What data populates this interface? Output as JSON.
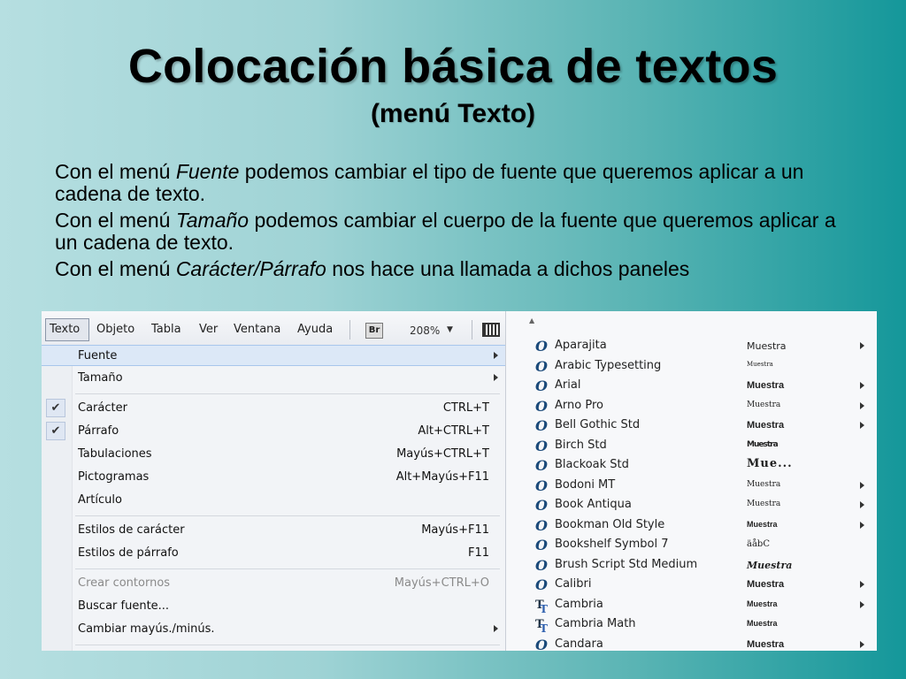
{
  "slide": {
    "title": "Colocación básica de textos",
    "subtitle": "(menú Texto)",
    "bullets": [
      {
        "pre": "Con el menú ",
        "em": "Fuente",
        "post": " podemos cambiar el tipo de fuente que queremos aplicar a un cadena de texto."
      },
      {
        "pre": "Con el menú ",
        "em": "Tamaño",
        "post": " podemos cambiar el cuerpo de la fuente que queremos aplicar a un cadena de texto."
      },
      {
        "pre": "Con el menú ",
        "em": "Carácter/Párrafo",
        "post": " nos hace una llamada a dichos paneles"
      }
    ]
  },
  "menubar": {
    "items": [
      "Texto",
      "Objeto",
      "Tabla",
      "Ver",
      "Ventana",
      "Ayuda"
    ],
    "br_label": "Br",
    "zoom": "208%"
  },
  "menu": {
    "items": [
      {
        "label": "Fuente",
        "shortcut": "",
        "submenu": true
      },
      {
        "label": "Tamaño",
        "shortcut": "",
        "submenu": true
      },
      {
        "label": "Carácter",
        "shortcut": "CTRL+T",
        "checked": true
      },
      {
        "label": "Párrafo",
        "shortcut": "Alt+CTRL+T",
        "checked": true
      },
      {
        "label": "Tabulaciones",
        "shortcut": "Mayús+CTRL+T"
      },
      {
        "label": "Pictogramas",
        "shortcut": "Alt+Mayús+F11"
      },
      {
        "label": "Artículo",
        "shortcut": ""
      },
      {
        "label": "Estilos de carácter",
        "shortcut": "Mayús+F11"
      },
      {
        "label": "Estilos de párrafo",
        "shortcut": "F11"
      },
      {
        "label": "Crear contornos",
        "shortcut": "Mayús+CTRL+O",
        "disabled": true
      },
      {
        "label": "Buscar fuente...",
        "shortcut": ""
      },
      {
        "label": "Cambiar mayús./minús.",
        "shortcut": "",
        "submenu": true
      }
    ]
  },
  "fonts": {
    "items": [
      {
        "name": "Aparajita",
        "sample": "Muestra",
        "icon": "opentype-icon",
        "arrow": true
      },
      {
        "name": "Arabic Typesetting",
        "sample": "Muestra",
        "icon": "opentype-icon",
        "arrow": false
      },
      {
        "name": "Arial",
        "sample": "Muestra",
        "icon": "opentype-icon",
        "arrow": true
      },
      {
        "name": "Arno Pro",
        "sample": "Muestra",
        "icon": "opentype-icon",
        "arrow": true
      },
      {
        "name": "Bell Gothic Std",
        "sample": "Muestra",
        "icon": "opentype-icon",
        "arrow": true
      },
      {
        "name": "Birch Std",
        "sample": "Muestra",
        "icon": "opentype-icon",
        "arrow": false
      },
      {
        "name": "Blackoak Std",
        "sample": "Mue...",
        "icon": "opentype-icon",
        "arrow": false
      },
      {
        "name": "Bodoni MT",
        "sample": "Muestra",
        "icon": "opentype-icon",
        "arrow": true
      },
      {
        "name": "Book Antiqua",
        "sample": "Muestra",
        "icon": "opentype-icon",
        "arrow": true
      },
      {
        "name": "Bookman Old Style",
        "sample": "Muestra",
        "icon": "opentype-icon",
        "arrow": true
      },
      {
        "name": "Bookshelf Symbol 7",
        "sample": "äåbC",
        "icon": "opentype-icon",
        "arrow": false
      },
      {
        "name": "Brush Script Std Medium",
        "sample": "Muestra",
        "icon": "opentype-icon",
        "arrow": false
      },
      {
        "name": "Calibri",
        "sample": "Muestra",
        "icon": "opentype-icon",
        "arrow": true
      },
      {
        "name": "Cambria",
        "sample": "Muestra",
        "icon": "truetype-icon",
        "arrow": true
      },
      {
        "name": "Cambria Math",
        "sample": "Muestra",
        "icon": "truetype-icon",
        "arrow": false
      },
      {
        "name": "Candara",
        "sample": "Muestra",
        "icon": "opentype-icon",
        "arrow": true
      }
    ]
  }
}
